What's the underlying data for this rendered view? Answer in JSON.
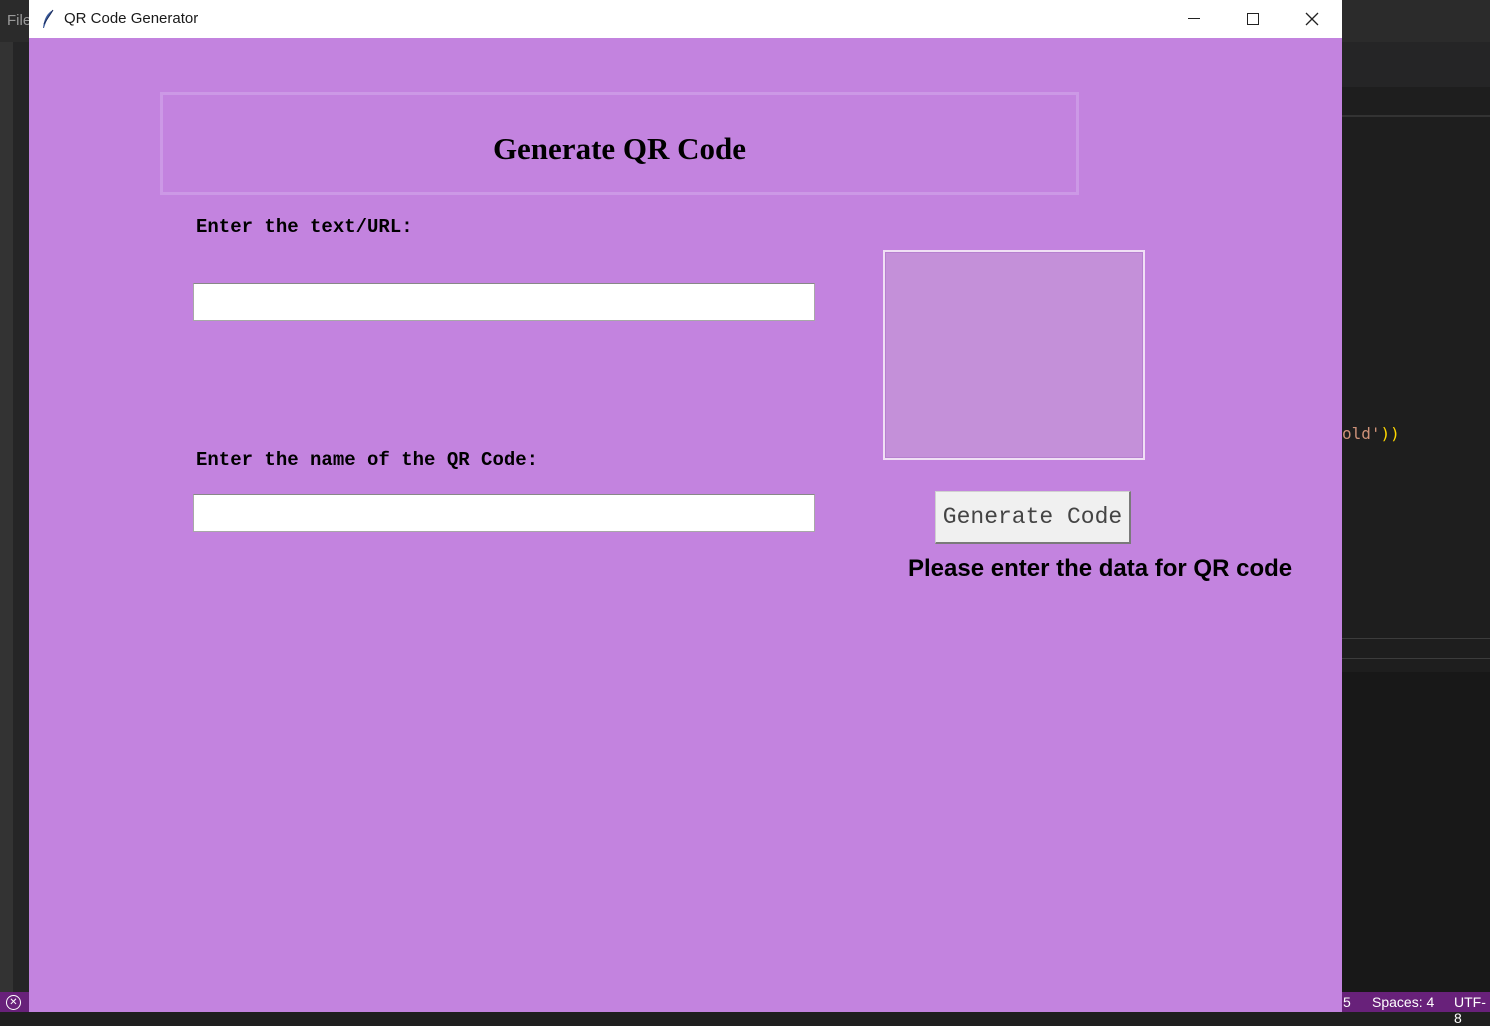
{
  "editor": {
    "menu_file": "File",
    "code_fragment_string": "old'",
    "code_fragment_parens": "))",
    "status_errors_icon": "error-circle-icon",
    "status_fragment": "5",
    "status_spaces": "Spaces: 4",
    "status_encoding": "UTF-8"
  },
  "window": {
    "title": "QR Code Generator",
    "app_icon": "tk-feather-icon",
    "background_color": "#c383df"
  },
  "main": {
    "heading": "Generate QR Code",
    "text_url_label": "Enter the text/URL:",
    "text_url_value": "",
    "name_label": "Enter the name of the QR Code:",
    "name_value": "",
    "generate_button_label": "Generate Code",
    "status_message": "Please enter the data for QR code"
  }
}
